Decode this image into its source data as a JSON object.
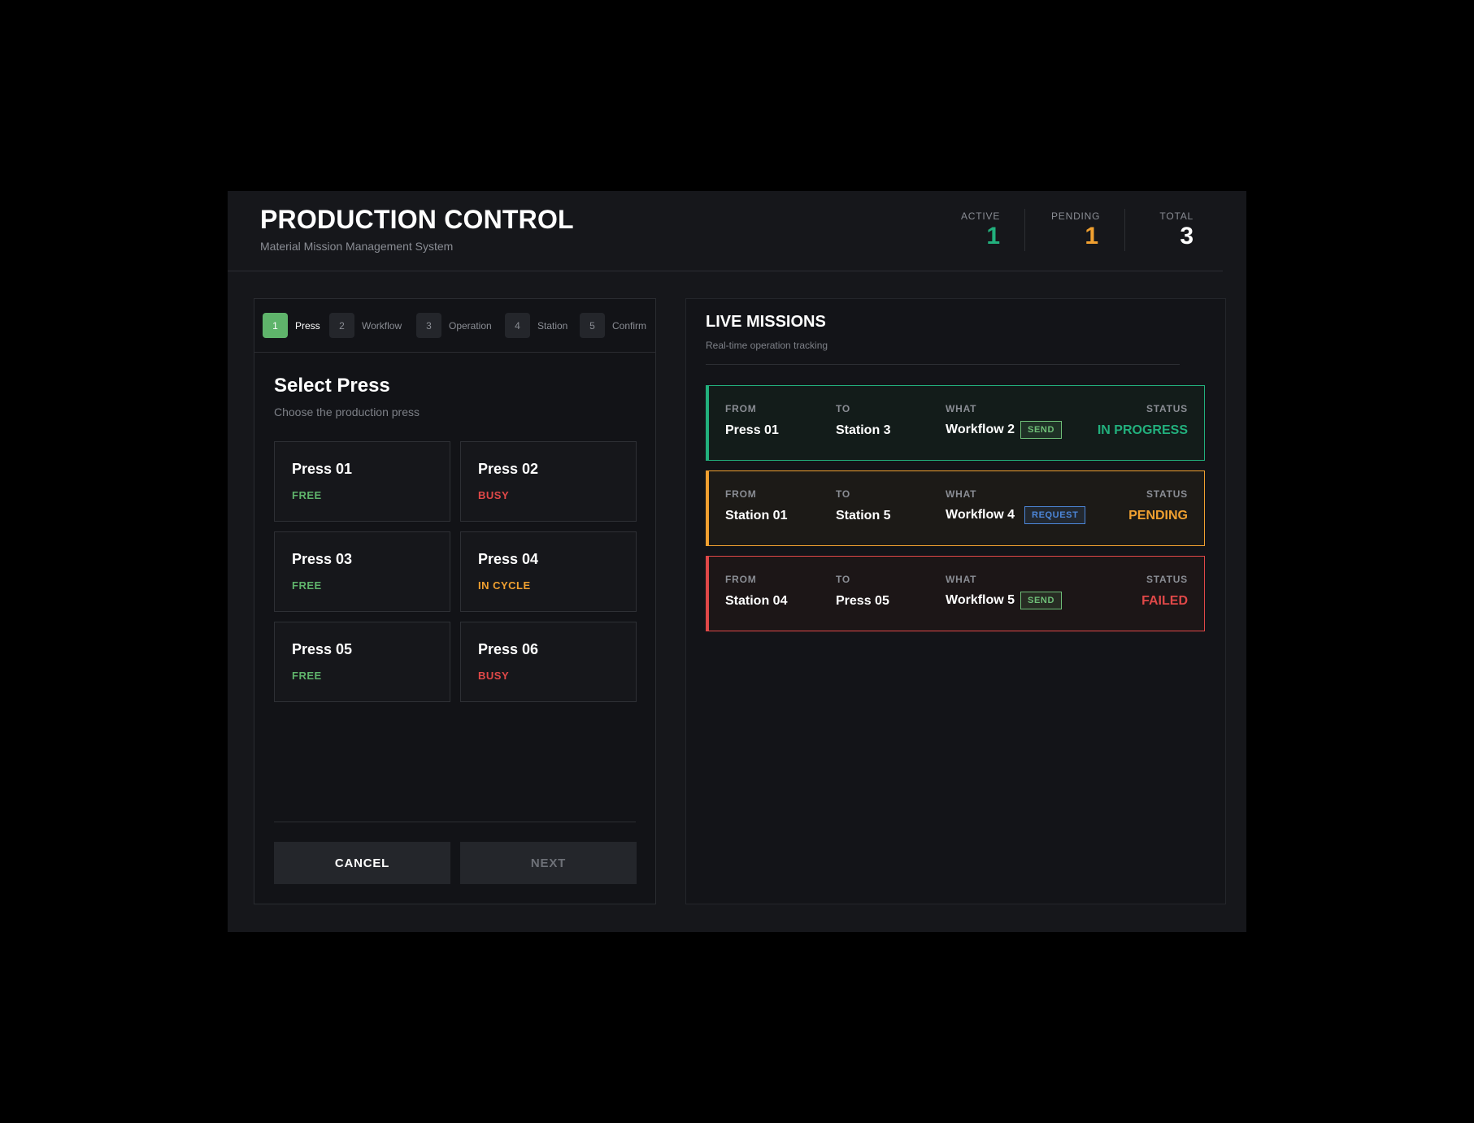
{
  "header": {
    "title": "PRODUCTION CONTROL",
    "subtitle": "Material Mission Management System",
    "stats": [
      {
        "label": "ACTIVE",
        "value": "1",
        "color": "#22b07d"
      },
      {
        "label": "PENDING",
        "value": "1",
        "color": "#f0a030"
      },
      {
        "label": "TOTAL",
        "value": "3",
        "color": "#ffffff"
      }
    ]
  },
  "steps": [
    {
      "num": "1",
      "label": "Press",
      "active": true
    },
    {
      "num": "2",
      "label": "Workflow",
      "active": false
    },
    {
      "num": "3",
      "label": "Operation",
      "active": false
    },
    {
      "num": "4",
      "label": "Station",
      "active": false
    },
    {
      "num": "5",
      "label": "Confirm",
      "active": false
    }
  ],
  "select": {
    "title": "Select Press",
    "subtitle": "Choose the production press",
    "presses": [
      {
        "name": "Press 01",
        "status": "FREE",
        "color": "#5fb46b"
      },
      {
        "name": "Press 02",
        "status": "BUSY",
        "color": "#e04848"
      },
      {
        "name": "Press 03",
        "status": "FREE",
        "color": "#5fb46b"
      },
      {
        "name": "Press 04",
        "status": "IN CYCLE",
        "color": "#f0a030"
      },
      {
        "name": "Press 05",
        "status": "FREE",
        "color": "#5fb46b"
      },
      {
        "name": "Press 06",
        "status": "BUSY",
        "color": "#e04848"
      }
    ],
    "cancel_label": "CANCEL",
    "next_label": "NEXT"
  },
  "missions": {
    "title": "LIVE MISSIONS",
    "subtitle": "Real-time operation tracking",
    "labels": {
      "from": "FROM",
      "to": "TO",
      "what": "WHAT",
      "status": "STATUS"
    },
    "items": [
      {
        "from": "Press 01",
        "to": "Station 3",
        "what": "Workflow 2",
        "tag": "SEND",
        "tag_color": "#6fbf78",
        "status": "IN PROGRESS",
        "color": "#22b07d",
        "bg": "#131c1a"
      },
      {
        "from": "Station 01",
        "to": "Station 5",
        "what": "Workflow 4",
        "tag": "REQUEST",
        "tag_color": "#4c86d8",
        "status": "PENDING",
        "color": "#f0a030",
        "bg": "#1c1a17"
      },
      {
        "from": "Station 04",
        "to": "Press 05",
        "what": "Workflow 5",
        "tag": "SEND",
        "tag_color": "#6fbf78",
        "status": "FAILED",
        "color": "#e04848",
        "bg": "#1c1617"
      }
    ]
  }
}
